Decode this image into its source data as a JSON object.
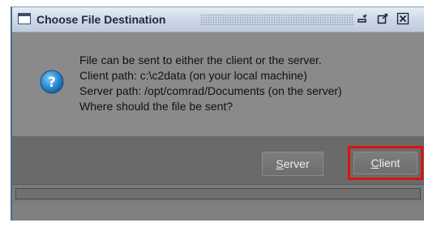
{
  "window": {
    "title": "Choose File Destination",
    "controls": [
      "minimize-icon",
      "maximize-icon",
      "close-icon"
    ]
  },
  "message": {
    "icon": "question-icon",
    "lines": [
      "File can be sent to either the client or the server.",
      "Client path: c:\\c2data (on your local machine)",
      "Server path: /opt/comrad/Documents (on the server)",
      "Where should the file be sent?"
    ]
  },
  "buttons": {
    "server": {
      "mnemonic": "S",
      "rest": "erver"
    },
    "client": {
      "mnemonic": "C",
      "rest": "lient"
    }
  },
  "colors": {
    "highlight": "#e01010",
    "question_icon": "#2a8fd6"
  }
}
